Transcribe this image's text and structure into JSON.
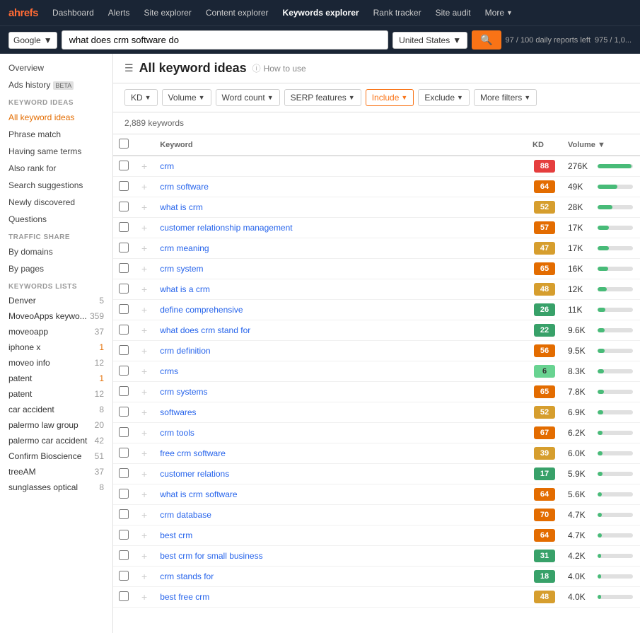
{
  "nav": {
    "logo": "ahrefs",
    "items": [
      {
        "label": "Dashboard",
        "active": false
      },
      {
        "label": "Alerts",
        "active": false
      },
      {
        "label": "Site explorer",
        "active": false
      },
      {
        "label": "Content explorer",
        "active": false
      },
      {
        "label": "Keywords explorer",
        "active": true
      },
      {
        "label": "Rank tracker",
        "active": false
      },
      {
        "label": "Site audit",
        "active": false
      },
      {
        "label": "More",
        "active": false,
        "hasChevron": true
      }
    ]
  },
  "searchBar": {
    "engine": "Google",
    "query": "what does crm software do",
    "country": "United States",
    "dailyReports": "97 / 100 daily reports left",
    "credits": "975 / 1,0..."
  },
  "sidebar": {
    "overview": "Overview",
    "adsHistory": "Ads history",
    "keywordIdeasLabel": "KEYWORD IDEAS",
    "keywordIdeas": [
      {
        "label": "All keyword ideas",
        "active": true
      },
      {
        "label": "Phrase match"
      },
      {
        "label": "Having same terms"
      },
      {
        "label": "Also rank for"
      },
      {
        "label": "Search suggestions"
      },
      {
        "label": "Newly discovered"
      },
      {
        "label": "Questions"
      }
    ],
    "trafficShareLabel": "TRAFFIC SHARE",
    "trafficShare": [
      {
        "label": "By domains"
      },
      {
        "label": "By pages"
      }
    ],
    "keywordsListsLabel": "KEYWORDS LISTS",
    "keywordsList": [
      {
        "label": "Denver",
        "count": "5"
      },
      {
        "label": "MoveoApps keywo...",
        "count": "359"
      },
      {
        "label": "moveoapp",
        "count": "37"
      },
      {
        "label": "iphone x",
        "count": "1",
        "highlight": true
      },
      {
        "label": "moveo info",
        "count": "12"
      },
      {
        "label": "patent",
        "count": "1"
      },
      {
        "label": "patent",
        "count": "12"
      },
      {
        "label": "car accident",
        "count": "8"
      },
      {
        "label": "palermo law group",
        "count": "20"
      },
      {
        "label": "palermo car accident",
        "count": "42"
      },
      {
        "label": "Confirm Bioscience",
        "count": "51"
      },
      {
        "label": "treeAM",
        "count": "37"
      },
      {
        "label": "sunglasses optical",
        "count": "8"
      }
    ]
  },
  "mainContent": {
    "title": "All keyword ideas",
    "howToUse": "How to use",
    "filters": [
      {
        "label": "KD",
        "active": false
      },
      {
        "label": "Volume",
        "active": false
      },
      {
        "label": "Word count",
        "active": false
      },
      {
        "label": "SERP features",
        "active": false
      },
      {
        "label": "Include",
        "active": true
      },
      {
        "label": "Exclude",
        "active": false
      },
      {
        "label": "More filters",
        "active": false
      }
    ],
    "keywordsCount": "2,889 keywords",
    "tableHeaders": {
      "keyword": "Keyword",
      "kd": "KD",
      "volume": "Volume ▼"
    },
    "keywords": [
      {
        "keyword": "crm",
        "kd": 88,
        "kdColor": "red",
        "volume": "276K",
        "barWidth": 95
      },
      {
        "keyword": "crm software",
        "kd": 64,
        "kdColor": "orange",
        "volume": "49K",
        "barWidth": 55
      },
      {
        "keyword": "what is crm",
        "kd": 52,
        "kdColor": "yellow",
        "volume": "28K",
        "barWidth": 42
      },
      {
        "keyword": "customer relationship management",
        "kd": 57,
        "kdColor": "orange",
        "volume": "17K",
        "barWidth": 32
      },
      {
        "keyword": "crm meaning",
        "kd": 47,
        "kdColor": "yellow",
        "volume": "17K",
        "barWidth": 32
      },
      {
        "keyword": "crm system",
        "kd": 65,
        "kdColor": "orange",
        "volume": "16K",
        "barWidth": 30
      },
      {
        "keyword": "what is a crm",
        "kd": 48,
        "kdColor": "yellow",
        "volume": "12K",
        "barWidth": 25
      },
      {
        "keyword": "define comprehensive",
        "kd": 26,
        "kdColor": "green",
        "volume": "11K",
        "barWidth": 22
      },
      {
        "keyword": "what does crm stand for",
        "kd": 22,
        "kdColor": "green",
        "volume": "9.6K",
        "barWidth": 20
      },
      {
        "keyword": "crm definition",
        "kd": 56,
        "kdColor": "orange",
        "volume": "9.5K",
        "barWidth": 20
      },
      {
        "keyword": "crms",
        "kd": 6,
        "kdColor": "light-green",
        "volume": "8.3K",
        "barWidth": 18
      },
      {
        "keyword": "crm systems",
        "kd": 65,
        "kdColor": "orange",
        "volume": "7.8K",
        "barWidth": 17
      },
      {
        "keyword": "softwares",
        "kd": 52,
        "kdColor": "yellow",
        "volume": "6.9K",
        "barWidth": 15
      },
      {
        "keyword": "crm tools",
        "kd": 67,
        "kdColor": "orange",
        "volume": "6.2K",
        "barWidth": 14
      },
      {
        "keyword": "free crm software",
        "kd": 39,
        "kdColor": "yellow",
        "volume": "6.0K",
        "barWidth": 13
      },
      {
        "keyword": "customer relations",
        "kd": 17,
        "kdColor": "green",
        "volume": "5.9K",
        "barWidth": 13
      },
      {
        "keyword": "what is crm software",
        "kd": 64,
        "kdColor": "orange",
        "volume": "5.6K",
        "barWidth": 12
      },
      {
        "keyword": "crm database",
        "kd": 70,
        "kdColor": "orange",
        "volume": "4.7K",
        "barWidth": 11
      },
      {
        "keyword": "best crm",
        "kd": 64,
        "kdColor": "orange",
        "volume": "4.7K",
        "barWidth": 11
      },
      {
        "keyword": "best crm for small business",
        "kd": 31,
        "kdColor": "green",
        "volume": "4.2K",
        "barWidth": 10
      },
      {
        "keyword": "crm stands for",
        "kd": 18,
        "kdColor": "green",
        "volume": "4.0K",
        "barWidth": 9
      },
      {
        "keyword": "best free crm",
        "kd": 48,
        "kdColor": "yellow",
        "volume": "4.0K",
        "barWidth": 9
      }
    ]
  }
}
